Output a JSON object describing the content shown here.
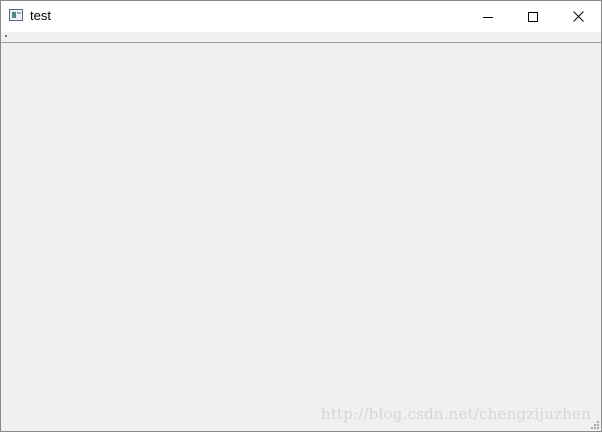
{
  "window": {
    "title": "test",
    "icon": "application-window-icon"
  },
  "controls": {
    "minimize_icon": "minimize-icon",
    "maximize_icon": "maximize-icon",
    "close_icon": "close-icon"
  },
  "watermark": {
    "text": "http://blog.csdn.net/chengzijuzhen"
  },
  "colors": {
    "titlebar": "#ffffff",
    "client_background": "#f0f0f0",
    "border": "#8a8a8a"
  }
}
